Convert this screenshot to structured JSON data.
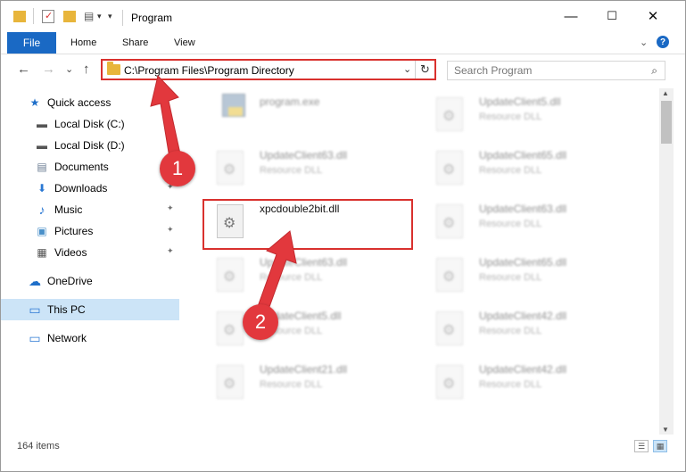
{
  "window": {
    "title": "Program",
    "minimize": "—",
    "maximize": "☐",
    "close": "✕"
  },
  "ribbon": {
    "tabs": [
      "File",
      "Home",
      "Share",
      "View"
    ],
    "help": "?",
    "collapse": "⌄"
  },
  "nav": {
    "back": "←",
    "forward": "→",
    "recent": "⌄",
    "up": "↑",
    "address": "C:\\Program Files\\Program Directory",
    "address_dropdown": "⌄",
    "refresh": "↻",
    "search_placeholder": "Search Program",
    "search_icon": "⌕"
  },
  "sidebar": {
    "items": [
      {
        "label": "Quick access",
        "icon": "star-icon",
        "glyph": "★",
        "color": "#1f6fc9"
      },
      {
        "label": "Local Disk (C:)",
        "icon": "drive-icon",
        "glyph": "▬",
        "color": "#555555"
      },
      {
        "label": "Local Disk (D:)",
        "icon": "drive-icon",
        "glyph": "▬",
        "color": "#555555"
      },
      {
        "label": "Documents",
        "icon": "document-icon",
        "glyph": "▤",
        "color": "#6b7c93"
      },
      {
        "label": "Downloads",
        "icon": "download-icon",
        "glyph": "⬇",
        "color": "#2b78d3",
        "pinned": true
      },
      {
        "label": "Music",
        "icon": "music-icon",
        "glyph": "♪",
        "color": "#2b78d3",
        "pinned": true
      },
      {
        "label": "Pictures",
        "icon": "picture-icon",
        "glyph": "▣",
        "color": "#4a90c9",
        "pinned": true
      },
      {
        "label": "Videos",
        "icon": "video-icon",
        "glyph": "▦",
        "color": "#555555",
        "pinned": true
      },
      {
        "label": "OneDrive",
        "icon": "cloud-icon",
        "glyph": "☁",
        "color": "#1f6fc9"
      },
      {
        "label": "This PC",
        "icon": "computer-icon",
        "glyph": "▭",
        "color": "#2b78d3",
        "selected": true
      },
      {
        "label": "Network",
        "icon": "network-icon",
        "glyph": "▭",
        "color": "#2b78d3"
      }
    ],
    "pin_glyph": "📌"
  },
  "files": [
    {
      "name": "program.exe",
      "type": "",
      "icon": "exe-icon"
    },
    {
      "name": "UpdateClient5.dll",
      "type": "Resource DLL",
      "icon": "dll-icon"
    },
    {
      "name": "UpdateClient63.dll",
      "type": "Resource DLL",
      "icon": "dll-icon"
    },
    {
      "name": "UpdateClient65.dll",
      "type": "Resource DLL",
      "icon": "dll-icon"
    },
    {
      "name": "xpcdouble2bit.dll",
      "type": "",
      "icon": "dll-icon",
      "highlighted": true
    },
    {
      "name": "UpdateClient63.dll",
      "type": "Resource DLL",
      "icon": "dll-icon"
    },
    {
      "name": "UpdateClient63.dll",
      "type": "Resource DLL",
      "icon": "dll-icon"
    },
    {
      "name": "UpdateClient65.dll",
      "type": "Resource DLL",
      "icon": "dll-icon"
    },
    {
      "name": "UpdateClient5.dll",
      "type": "Resource DLL",
      "icon": "dll-icon"
    },
    {
      "name": "UpdateClient42.dll",
      "type": "Resource DLL",
      "icon": "dll-icon"
    },
    {
      "name": "UpdateClient21.dll",
      "type": "Resource DLL",
      "icon": "dll-icon"
    },
    {
      "name": "UpdateClient42.dll",
      "type": "Resource DLL",
      "icon": "dll-icon"
    }
  ],
  "gear_glyph": "⚙",
  "status": {
    "count": "164 items"
  },
  "callouts": [
    "1",
    "2"
  ],
  "colors": {
    "accent": "#1a69c4",
    "highlight": "#d9312e",
    "callout": "#e2383d",
    "selection": "#cce4f7"
  }
}
